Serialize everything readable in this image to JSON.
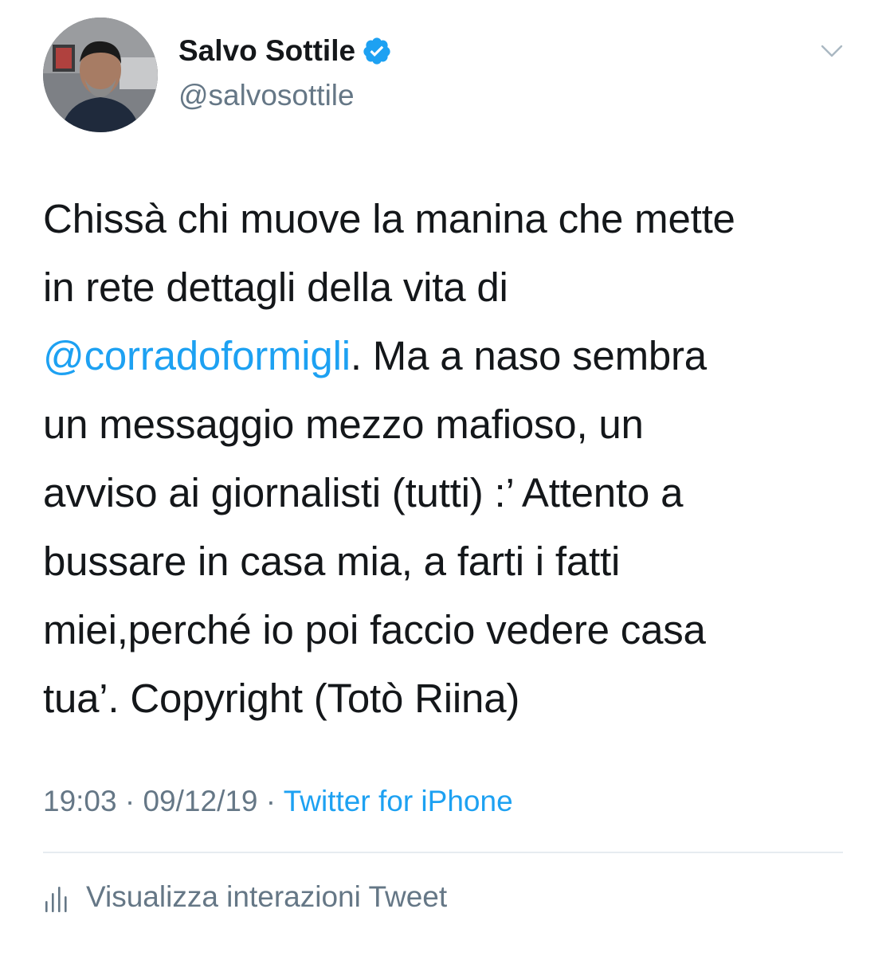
{
  "tweet": {
    "author_name": "Salvo Sottile",
    "handle": "@salvosottile",
    "verified": true,
    "body_lines": [
      {
        "segments": [
          {
            "text": "Chissà chi muove la manina che mette",
            "type": "text"
          }
        ]
      },
      {
        "segments": [
          {
            "text": "in rete dettagli della vita di",
            "type": "text"
          }
        ]
      },
      {
        "segments": [
          {
            "text": "@corradoformigli",
            "type": "mention"
          },
          {
            "text": ". Ma a naso sembra",
            "type": "text"
          }
        ]
      },
      {
        "segments": [
          {
            "text": "un messaggio mezzo mafioso, un",
            "type": "text"
          }
        ]
      },
      {
        "segments": [
          {
            "text": "avviso ai giornalisti (tutti) :’ Attento a",
            "type": "text"
          }
        ]
      },
      {
        "segments": [
          {
            "text": "bussare in casa mia, a farti i fatti",
            "type": "text"
          }
        ]
      },
      {
        "segments": [
          {
            "text": "miei,perché io poi faccio vedere casa",
            "type": "text"
          }
        ]
      },
      {
        "segments": [
          {
            "text": "tua’. Copyright (Totò Riina)",
            "type": "text"
          }
        ]
      }
    ],
    "time": "19:03",
    "separator": "·",
    "date": "09/12/19",
    "source": "Twitter for iPhone",
    "activity_label": "Visualizza interazioni Tweet"
  },
  "icons": {
    "verified": "verified-badge-icon",
    "caret": "chevron-down-icon",
    "activity": "analytics-bars-icon"
  },
  "colors": {
    "text": "#14171a",
    "secondary": "#657786",
    "accent": "#1da1f2",
    "divider": "#e6ecf0"
  }
}
